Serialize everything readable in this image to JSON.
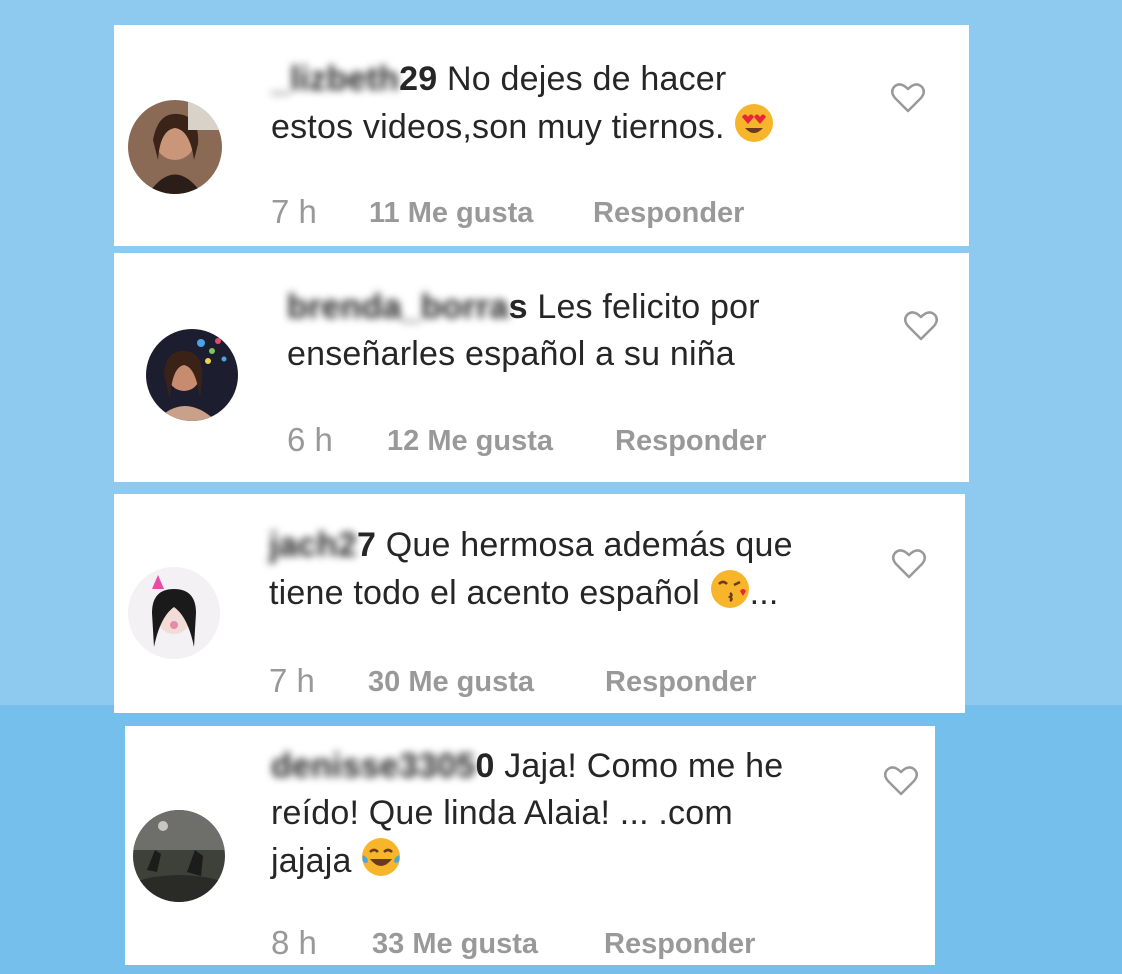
{
  "comments": [
    {
      "username_blurred": "_lizbeth",
      "username_suffix": "29",
      "line1": "No dejes de hacer",
      "line2": "estos videos,son muy tiernos.",
      "line3": "",
      "emoji": "heart-eyes-emoji",
      "time": "7 h",
      "likes": "11 Me gusta",
      "reply": "Responder"
    },
    {
      "username_blurred": "brenda_borra",
      "username_suffix": "s",
      "line1": "Les felicito por",
      "line2": "enseñarles español a su niña",
      "line3": "",
      "emoji": "",
      "time": "6 h",
      "likes": "12 Me gusta",
      "reply": "Responder"
    },
    {
      "username_blurred": "jach2",
      "username_suffix": "7",
      "line1": "Que hermosa además que",
      "line2": "tiene todo el acento español",
      "line2_end": "...",
      "line3": "",
      "emoji": "kiss-emoji",
      "time": "7 h",
      "likes": "30 Me gusta",
      "reply": "Responder"
    },
    {
      "username_blurred": "denisse3305",
      "username_suffix": "0",
      "line1": "Jaja! Como me he",
      "line2": "reído! Que linda Alaia! ... .com",
      "line3": "jajaja",
      "emoji": "tears-of-joy-emoji",
      "time": "8 h",
      "likes": "33 Me gusta",
      "reply": "Responder"
    }
  ],
  "colors": {
    "background_top": "#8ec9ef",
    "background_bottom": "#74bfeb",
    "text": "#262626",
    "meta": "#999999"
  }
}
